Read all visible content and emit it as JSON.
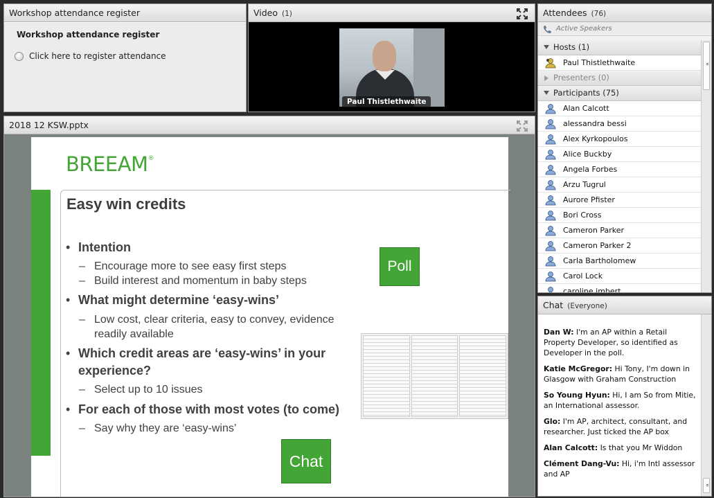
{
  "register_pod": {
    "title": "Workshop attendance register",
    "heading": "Workshop attendance register",
    "option_label": "Click here to register attendance"
  },
  "video_pod": {
    "title": "Video",
    "count": "(1)",
    "presenter_name": "Paul Thistlethwaite"
  },
  "share_pod": {
    "title": "2018 12 KSW.pptx",
    "slide": {
      "logo": "BREEAM",
      "logo_mark": "®",
      "title": "Easy win credits",
      "bullets": [
        {
          "text": "Intention"
        },
        {
          "text": "Encourage more to see easy first steps"
        },
        {
          "text": "Build interest and momentum in baby steps"
        },
        {
          "text": "What might determine ‘easy-wins’"
        },
        {
          "text": "Low cost, clear criteria, easy to convey, evidence"
        },
        {
          "text": "readily available"
        },
        {
          "text": "Which credit areas are ‘easy-wins’ in your"
        },
        {
          "text": "experience?"
        },
        {
          "text": "Select up to 10 issues"
        },
        {
          "text": "For each of those with most votes (to come)"
        },
        {
          "text": "Say why they are ‘easy-wins’"
        }
      ],
      "poll_button": "Poll",
      "chat_button": "Chat",
      "brand_color": "#43a535"
    }
  },
  "attendees_pod": {
    "title": "Attendees",
    "count": "(76)",
    "active_speakers": "Active Speakers",
    "hosts_label": "Hosts (1)",
    "hosts": [
      "Paul Thistlethwaite"
    ],
    "presenters_label": "Presenters (0)",
    "participants_label": "Participants (75)",
    "participants": [
      "Alan Calcott",
      "alessandra bessi",
      "Alex Kyrkopoulos",
      "Alice Buckby",
      "Angela Forbes",
      "Arzu Tugrul",
      "Aurore Pfister",
      "Bori Cross",
      "Cameron Parker",
      "Cameron Parker 2",
      "Carla Bartholomew",
      "Carol Lock",
      "caroline imbert"
    ]
  },
  "chat_pod": {
    "title": "Chat",
    "scope": "(Everyone)",
    "messages": [
      {
        "author": "Dan W:",
        "text": "I'm an AP within a Retail Property Developer, so identified as Developer in the poll."
      },
      {
        "author": "Katie McGregor:",
        "text": "Hi Tony, I'm down in Glasgow with Graham Construction"
      },
      {
        "author": "So Young Hyun:",
        "text": "Hi, I am So from Mitie, an International assessor."
      },
      {
        "author": "Glo:",
        "text": "I'm AP, architect, consultant, and researcher. Just ticked the AP box"
      },
      {
        "author": "Alan Calcott:",
        "text": "Is that you Mr Widdon"
      },
      {
        "author": "Clément Dang-Vu:",
        "text": "Hi, i'm Intl assessor and AP"
      }
    ]
  }
}
